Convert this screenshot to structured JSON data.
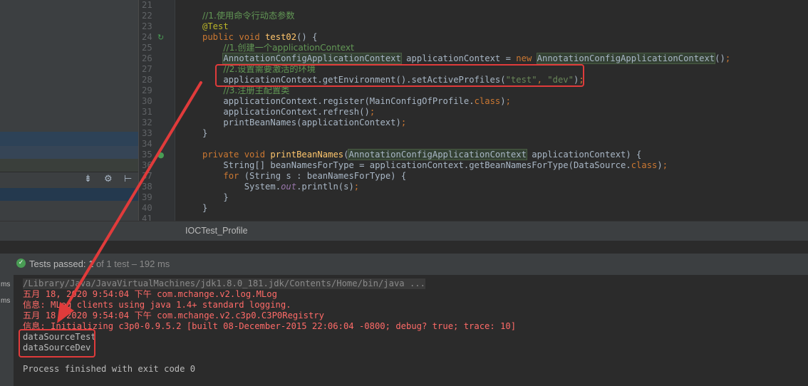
{
  "editor": {
    "lines": [
      {
        "num": "21",
        "html": ""
      },
      {
        "num": "22",
        "html": "<span class=\"cm\">//1.使用命令行动态参数</span>"
      },
      {
        "num": "23",
        "html": "<span class=\"an\">@Test</span>"
      },
      {
        "num": "24",
        "html": "<span class=\"kw\">public void </span><span class=\"fn\">test02</span>() {"
      },
      {
        "num": "25",
        "html": "    <span class=\"cm\">//1.创建一个applicationContext</span>"
      },
      {
        "num": "26",
        "html": "    <span class=\"hl\">AnnotationConfigApplicationContext</span> applicationContext = <span class=\"kw\">new </span><span class=\"hl\">AnnotationConfigApplicationContext</span>()<span class=\"kw\">;</span>"
      },
      {
        "num": "27",
        "html": "    <span class=\"cm\">//2.设置需要激活的环境</span>"
      },
      {
        "num": "28",
        "html": "    applicationContext.getEnvironment().setActiveProfiles(<span class=\"st\">\"test\"</span><span class=\"kw\">, </span><span class=\"st\">\"dev\"</span>)<span class=\"kw\">;</span>"
      },
      {
        "num": "29",
        "html": "    <span class=\"cm\">//3.注册主配置类</span>"
      },
      {
        "num": "30",
        "html": "    applicationContext.register(MainConfigOfProfile.<span class=\"kw\">class</span>)<span class=\"kw\">;</span>"
      },
      {
        "num": "31",
        "html": "    applicationContext.refresh()<span class=\"kw\">;</span>"
      },
      {
        "num": "32",
        "html": "    printBeanNames(applicationContext)<span class=\"kw\">;</span>"
      },
      {
        "num": "33",
        "html": "}"
      },
      {
        "num": "34",
        "html": ""
      },
      {
        "num": "35",
        "html": "<span class=\"kw\">private void </span><span class=\"fn\">printBeanNames</span>(<span class=\"hl\">AnnotationConfigApplicationContext</span> applicationContext) {"
      },
      {
        "num": "36",
        "html": "    String[] beanNamesForType = applicationContext.getBeanNamesForType(DataSource.<span class=\"kw\">class</span>)<span class=\"kw\">;</span>"
      },
      {
        "num": "37",
        "html": "    <span class=\"kw\">for </span>(String s : beanNamesForType) {"
      },
      {
        "num": "38",
        "html": "        System.<span class=\"it\">out</span>.println(s)<span class=\"kw\">;</span>"
      },
      {
        "num": "39",
        "html": "    }"
      },
      {
        "num": "40",
        "html": "}"
      },
      {
        "num": "41",
        "html": ""
      }
    ]
  },
  "tab": {
    "label": "IOCTest_Profile"
  },
  "status": {
    "tests_passed": "Tests passed: 1",
    "tests_detail": " of 1 test – 192 ms"
  },
  "gutter_ms": [
    "ms",
    "ms"
  ],
  "console": {
    "path": "/Library/Java/JavaVirtualMachines/jdk1.8.0_181.jdk/Contents/Home/bin/java ...",
    "lines": [
      {
        "text": "五月 18, 2020 9:54:04 下午 com.mchange.v2.log.MLog",
        "style": "red"
      },
      {
        "text": "信息: MLog clients using java 1.4+ standard logging.",
        "style": "red"
      },
      {
        "text": "五月 18, 2020 9:54:04 下午 com.mchange.v2.c3p0.C3P0Registry",
        "style": "red"
      },
      {
        "text": "信息: Initializing c3p0-0.9.5.2 [built 08-December-2015 22:06:04 -0800; debug? true; trace: 10]",
        "style": "red"
      },
      {
        "text": "dataSourceTest",
        "style": "norm"
      },
      {
        "text": "dataSourceDev",
        "style": "norm"
      },
      {
        "text": "",
        "style": "norm"
      },
      {
        "text": "Process finished with exit code 0",
        "style": "norm"
      }
    ]
  },
  "colors": {
    "annotation_red": "#e03b3b",
    "pass_green": "#499c54",
    "error_red": "#ff6b68"
  }
}
